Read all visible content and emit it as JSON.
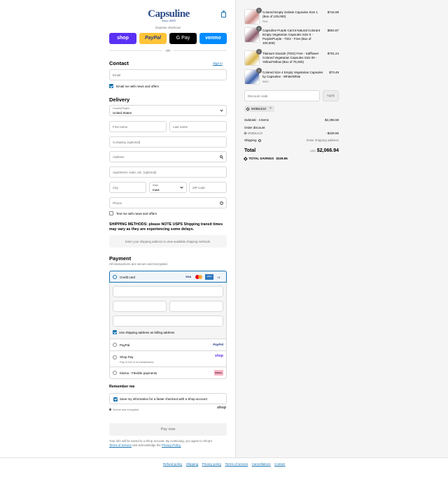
{
  "brand": {
    "name": "Capsuline",
    "tagline": "Since 2003"
  },
  "express": {
    "title": "Express checkout",
    "buttons": [
      {
        "name": "shop",
        "label": "shop",
        "color": "#5a31f4"
      },
      {
        "name": "paypal",
        "label": "PayPal",
        "color": "#ffc439"
      },
      {
        "name": "gpay",
        "label": "G Pay",
        "color": "#000000"
      },
      {
        "name": "venmo",
        "label": "venmo",
        "color": "#008cff"
      }
    ],
    "or": "OR"
  },
  "contact": {
    "title": "Contact",
    "sign_in": "Sign in",
    "email_placeholder": "Email",
    "news_label": "Email me with news and offers",
    "news_checked": true
  },
  "delivery": {
    "title": "Delivery",
    "country_label": "Country/Region",
    "country_value": "United States",
    "first_name": "First name",
    "last_name": "Last name",
    "company": "Company (optional)",
    "address": "Address",
    "apartment": "Apartment, suite, etc. (optional)",
    "city": "City",
    "state_label": "State",
    "state_value": "Iowa",
    "zip": "ZIP code",
    "phone": "Phone",
    "text_label": "Text me with news and offers"
  },
  "shipping": {
    "notice": "SHIPPING METHODS: please NOTE USPS Shipping transit times may vary as they are experiencing some delays.",
    "placeholder": "Enter your shipping address to view available shipping methods."
  },
  "payment": {
    "title": "Payment",
    "subtitle": "All transactions are secure and encrypted.",
    "credit_card": "Credit card",
    "card_icons": [
      "VISA",
      "mastercard",
      "AMEX",
      "+1"
    ],
    "billing_label": "Use shipping address as billing address",
    "methods": [
      {
        "label": "PayPal",
        "sub": "",
        "logo": "PayPal",
        "logo_color": "#253b80"
      },
      {
        "label": "Shop Pay",
        "sub": "Pay in full or in installments",
        "logo": "shop",
        "logo_color": "#5a31f4"
      },
      {
        "label": "Klarna - Flexible payments",
        "sub": "",
        "logo": "Klarna.",
        "logo_color": "#ffb3c7"
      }
    ]
  },
  "remember": {
    "title": "Remember me",
    "label": "Save my information for a faster checkout with a Shop account",
    "secure": "Secure and encrypted",
    "shop_logo": "shop"
  },
  "pay_now": "Pay now",
  "legal": {
    "text": "Your info will be saved to a Shop account. By continuing, you agree to Shop's",
    "terms": "Terms of Service",
    "and": "and acknowledge the",
    "privacy": "Privacy Policy."
  },
  "footer": [
    "Refund policy",
    "Shipping",
    "Privacy policy",
    "Terms of service",
    "Cancellations",
    "Contact"
  ],
  "cart": {
    "items": [
      {
        "qty": "1",
        "title": "Colored Empty Gelatin Capsules Size 1 (Box of 125,000)",
        "variant": "Pink",
        "price": "$716.99",
        "thumb": "#c98a86"
      },
      {
        "qty": "1",
        "title": "Capsuline Purple Carrot Natural Colorant Empty Vegetarian Capsules Size 0 - Purple/Purple - TiO2 - Free (Box of 100,000)",
        "variant": "",
        "price": "$804.87",
        "thumb": "#8a5a6a"
      },
      {
        "qty": "1",
        "title": "Titanium Dioxide (TiO2) Free - Safflower Colored Vegetarian Capsules Size 00 - Yellow/Yellow (Box of 75,000)",
        "variant": "",
        "price": "$701.24",
        "thumb": "#d8b44a"
      },
      {
        "qty": "1",
        "title": "Colored Size 4 Empty Vegetarian Capsules by Capsuline - White/White",
        "variant": "5000",
        "price": "$73.49",
        "thumb": "#3b5ea8"
      }
    ],
    "discount_placeholder": "Discount code",
    "apply": "Apply",
    "code": "MOBILE10",
    "subtotal_label": "Subtotal · 4 items",
    "subtotal": "$2,296.59",
    "order_discount_label": "Order discount",
    "order_discount": "- $229.65",
    "shipping_label": "Shipping",
    "shipping_value": "Enter shipping address",
    "total_label": "Total",
    "currency": "USD",
    "total": "$2,066.94",
    "savings_label": "TOTAL SAVINGS",
    "savings": "$229.65"
  }
}
